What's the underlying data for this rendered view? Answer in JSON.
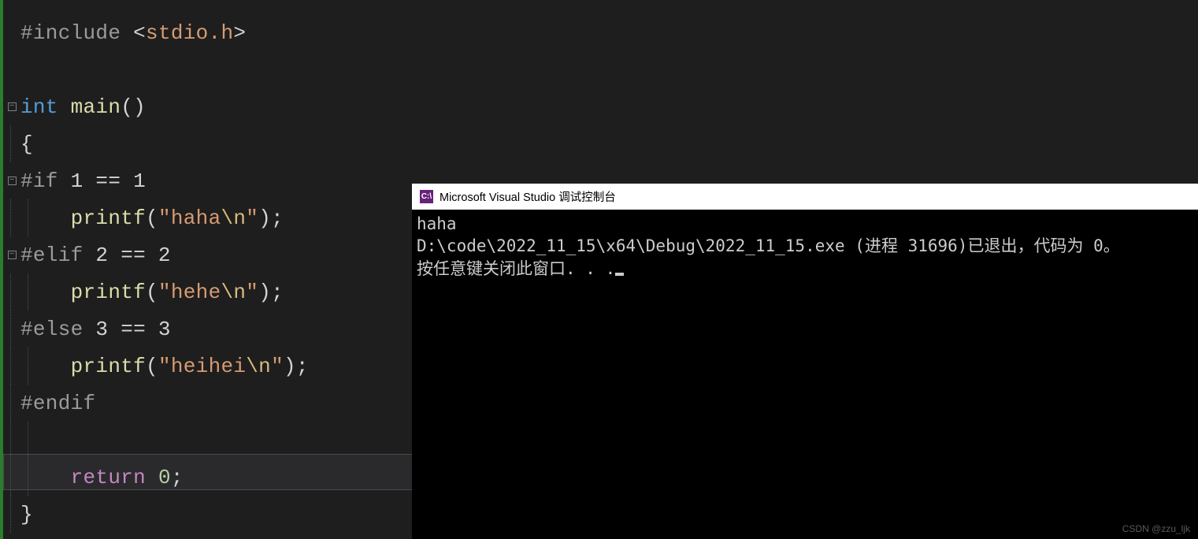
{
  "code": {
    "l1": {
      "include": "#include",
      "open": "<",
      "hdr": "stdio.h",
      "close": ">"
    },
    "l3": {
      "type": "int",
      "name": "main",
      "parens": "()"
    },
    "l4": {
      "brace": "{"
    },
    "l5": {
      "if": "#if",
      "expr": " 1 == 1"
    },
    "l6": {
      "fn": "printf",
      "open": "(",
      "q1": "\"",
      "str": "haha",
      "esc": "\\n",
      "q2": "\"",
      "close": ")",
      "semi": ";"
    },
    "l7": {
      "elif": "#elif",
      "expr": " 2 == 2"
    },
    "l8": {
      "fn": "printf",
      "open": "(",
      "q1": "\"",
      "str": "hehe",
      "esc": "\\n",
      "q2": "\"",
      "close": ")",
      "semi": ";"
    },
    "l9": {
      "else": "#else",
      "expr": " 3 == 3"
    },
    "l10": {
      "fn": "printf",
      "open": "(",
      "q1": "\"",
      "str": "heihei",
      "esc": "\\n",
      "q2": "\"",
      "close": ")",
      "semi": ";"
    },
    "l11": {
      "endif": "#endif"
    },
    "l13": {
      "ret": "return",
      "sp": " ",
      "zero": "0",
      "semi": ";"
    },
    "l14": {
      "brace": "}"
    }
  },
  "console": {
    "icon": "C:\\",
    "title": "Microsoft Visual Studio 调试控制台",
    "out1": "haha",
    "out2": "",
    "out3": "D:\\code\\2022_11_15\\x64\\Debug\\2022_11_15.exe (进程 31696)已退出，代码为 0。",
    "out4": "按任意键关闭此窗口. . ."
  },
  "watermark": "CSDN @zzu_ljk"
}
